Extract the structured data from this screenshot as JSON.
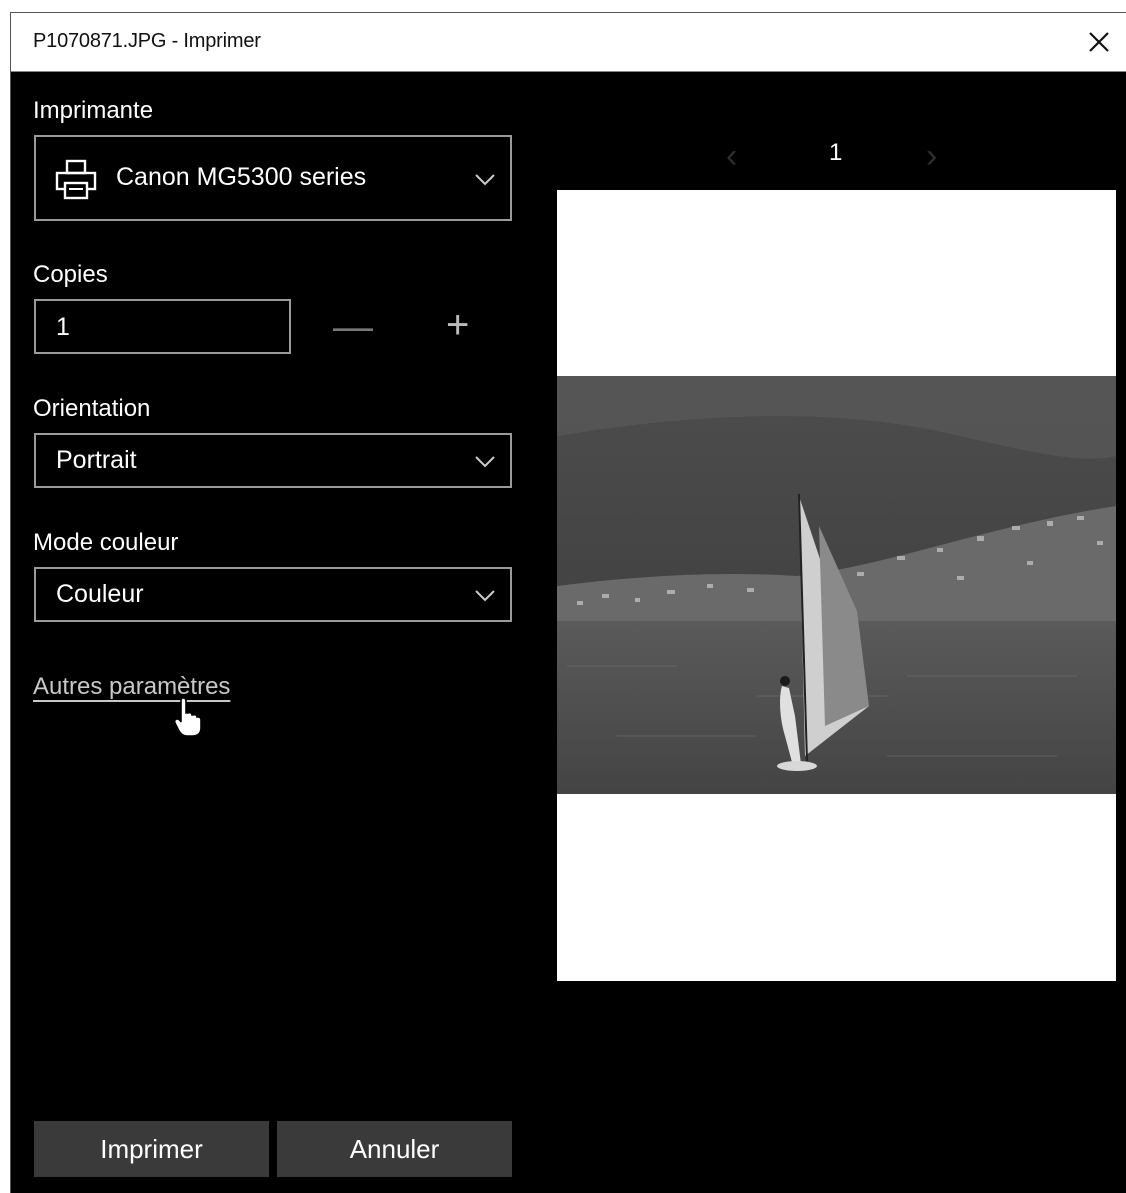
{
  "window": {
    "title": "P1070871.JPG - Imprimer"
  },
  "printer": {
    "label": "Imprimante",
    "value": "Canon MG5300 series",
    "icon": "printer-icon"
  },
  "copies": {
    "label": "Copies",
    "value": "1",
    "minus": "—",
    "plus": "+"
  },
  "orientation": {
    "label": "Orientation",
    "value": "Portrait"
  },
  "color_mode": {
    "label": "Mode couleur",
    "value": "Couleur"
  },
  "more_settings": {
    "label": "Autres paramètres"
  },
  "pager": {
    "prev": "‹",
    "page": "1",
    "next": "›"
  },
  "buttons": {
    "print": "Imprimer",
    "cancel": "Annuler"
  },
  "colors": {
    "background": "#000000",
    "field_border": "#9a9a9a",
    "button_bg": "#3a3a3a",
    "disabled": "#777777"
  }
}
